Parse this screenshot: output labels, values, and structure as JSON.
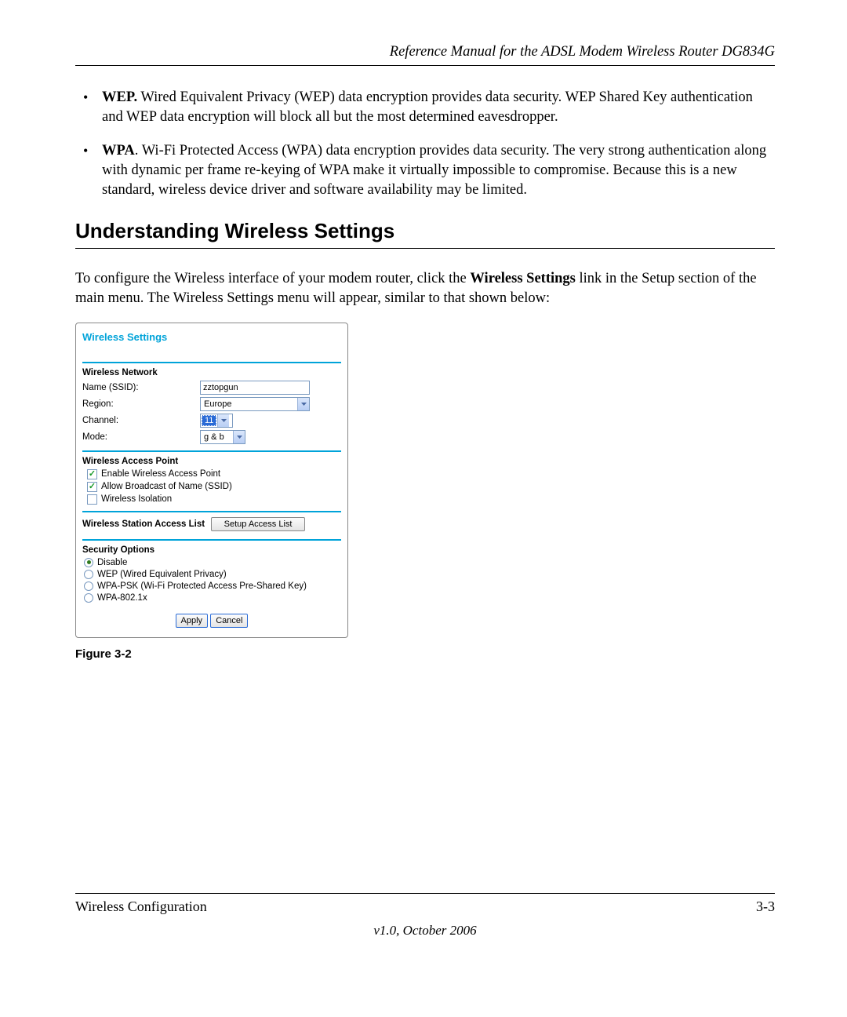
{
  "header": {
    "title": "Reference Manual for the ADSL Modem Wireless Router DG834G"
  },
  "bullets": {
    "wep": {
      "lead": "WEP.",
      "text": " Wired Equivalent Privacy (WEP) data encryption provides data security. WEP Shared Key authentication and WEP data encryption will block all but the most determined eavesdropper."
    },
    "wpa": {
      "lead": "WPA",
      "text": ". Wi-Fi Protected Access (WPA) data encryption provides data security. The very strong authentication along with dynamic per frame re-keying of WPA make it virtually impossible to compromise. Because this is a new standard, wireless device driver and software availability may be limited."
    }
  },
  "section": {
    "heading": "Understanding Wireless Settings",
    "paragraph_pre": "To configure the Wireless interface of your modem router, click the ",
    "paragraph_bold": "Wireless Settings",
    "paragraph_post": " link in the Setup section of the main menu. The Wireless Settings menu will appear, similar to that shown below:"
  },
  "panel": {
    "title": "Wireless Settings",
    "network": {
      "label": "Wireless Network",
      "ssid": {
        "label": "Name (SSID):",
        "value": "zztopgun"
      },
      "region": {
        "label": "Region:",
        "selected": "Europe"
      },
      "channel": {
        "label": "Channel:",
        "selected": "11"
      },
      "mode": {
        "label": "Mode:",
        "selected": "g & b"
      }
    },
    "ap": {
      "label": "Wireless Access Point",
      "enable": {
        "label": "Enable Wireless Access Point",
        "checked": true
      },
      "broadcast": {
        "label": "Allow Broadcast of Name (SSID)",
        "checked": true
      },
      "isolation": {
        "label": "Wireless Isolation",
        "checked": false
      }
    },
    "accesslist": {
      "label": "Wireless Station Access List",
      "button": "Setup Access List"
    },
    "security": {
      "label": "Security Options",
      "options": {
        "disable": {
          "label": "Disable",
          "selected": true
        },
        "wep": {
          "label": "WEP (Wired Equivalent Privacy)",
          "selected": false
        },
        "wpa_psk": {
          "label": "WPA-PSK (Wi-Fi Protected Access Pre-Shared Key)",
          "selected": false
        },
        "wpa_8021x": {
          "label": "WPA-802.1x",
          "selected": false
        }
      }
    },
    "buttons": {
      "apply": "Apply",
      "cancel": "Cancel"
    }
  },
  "figure": {
    "caption": "Figure 3-2"
  },
  "footer": {
    "left": "Wireless Configuration",
    "right": "3-3",
    "version": "v1.0, October 2006"
  }
}
